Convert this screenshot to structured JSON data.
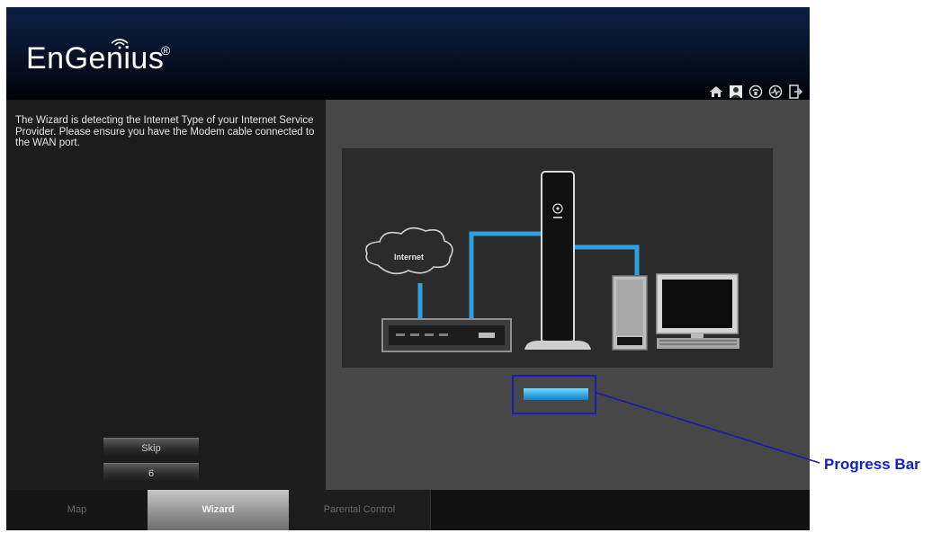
{
  "header": {
    "logo_text": "EnGenius",
    "logo_mark": "®",
    "icons": [
      "home-icon",
      "user-icon",
      "wireless-setup-icon",
      "wps-icon",
      "logout-icon"
    ]
  },
  "wizard": {
    "message": "The Wizard is detecting the Internet Type of your Internet Service Provider. Please ensure you have the Modem cable connected to the WAN port.",
    "illustration": {
      "cloud_label": "Internet"
    },
    "progress_fraction": 1.0,
    "skip_label": "Skip",
    "countdown": "6"
  },
  "tabs": [
    {
      "label": "Map",
      "active": false
    },
    {
      "label": "Wizard",
      "active": true
    },
    {
      "label": "Parental Control",
      "active": false
    }
  ],
  "annotation": {
    "label": "Progress Bar"
  },
  "colors": {
    "accent_blue": "#2f9fe0",
    "annotation_blue": "#1a1ab4",
    "panel_dark": "#1c1c1c",
    "panel_gray": "#474747"
  }
}
